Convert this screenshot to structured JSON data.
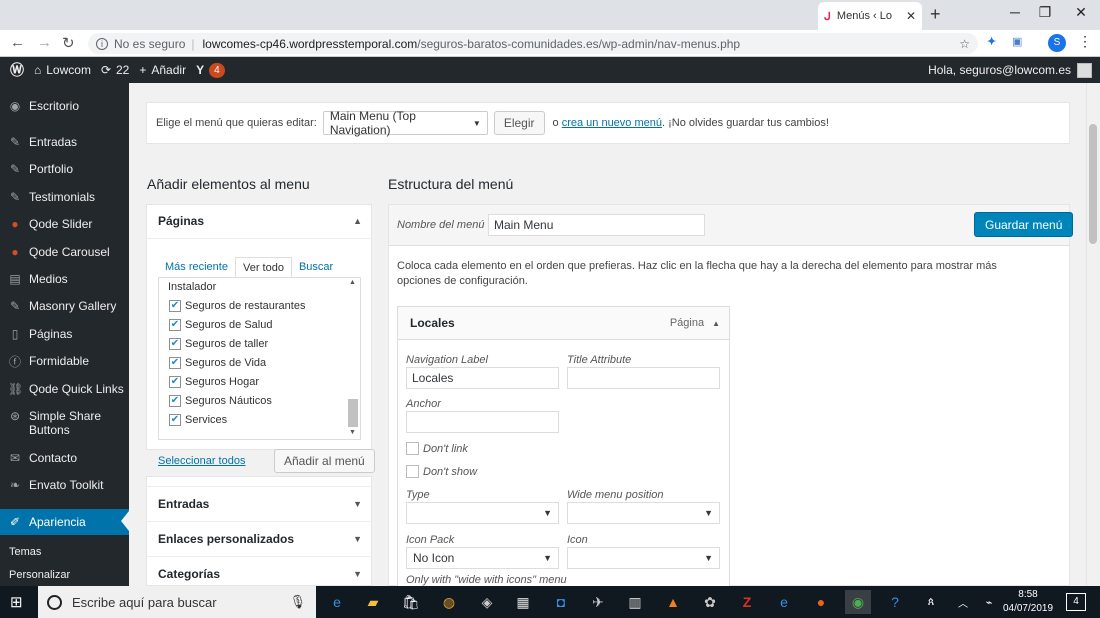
{
  "browser": {
    "tab_title": "Menús ‹ Lo",
    "tab_close": "✕",
    "new_tab": "+",
    "not_secure": "No es seguro",
    "url_host": "lowcomes-cp46.wordpresstemporal.com",
    "url_path": "/seguros-baratos-comunidades.es/wp-admin/nav-menus.php",
    "profile_initial": "S"
  },
  "adminbar": {
    "site": "Lowcom",
    "updates": "22",
    "add_new": "Añadir",
    "yoast_count": "4",
    "howdy": "Hola, seguros@lowcom.es"
  },
  "sidebar": {
    "items": [
      {
        "label": "Escritorio",
        "icon": "dashboard-icon"
      },
      {
        "label": "Entradas",
        "icon": "pin-icon"
      },
      {
        "label": "Portfolio",
        "icon": "pin-icon"
      },
      {
        "label": "Testimonials",
        "icon": "pin-icon"
      },
      {
        "label": "Qode Slider",
        "icon": "circle-icon"
      },
      {
        "label": "Qode Carousel",
        "icon": "circle-icon"
      },
      {
        "label": "Medios",
        "icon": "media-icon"
      },
      {
        "label": "Masonry Gallery",
        "icon": "pin-icon"
      },
      {
        "label": "Páginas",
        "icon": "page-icon"
      },
      {
        "label": "Formidable",
        "icon": "form-icon"
      },
      {
        "label": "Qode Quick Links",
        "icon": "link-icon"
      },
      {
        "label": "Simple Share Buttons",
        "icon": "share-icon"
      },
      {
        "label": "Contacto",
        "icon": "mail-icon"
      },
      {
        "label": "Envato Toolkit",
        "icon": "leaf-icon"
      },
      {
        "label": "Apariencia",
        "icon": "brush-icon"
      }
    ],
    "submenu": [
      "Temas",
      "Personalizar"
    ]
  },
  "select_menu": {
    "prompt": "Elige el menú que quieras editar:",
    "selected": "Main Menu (Top Navigation)",
    "choose_button": "Elegir",
    "or": "o",
    "create_link": "crea un nuevo menú",
    "reminder": ". ¡No olvides guardar tus cambios!"
  },
  "add_items": {
    "heading": "Añadir elementos al menu",
    "pages_section": "Páginas",
    "tabs": [
      "Más reciente",
      "Ver todo",
      "Buscar"
    ],
    "partial_item": "Instalador",
    "pages": [
      "Seguros de restaurantes",
      "Seguros de Salud",
      "Seguros de taller",
      "Seguros de Vida",
      "Seguros Hogar",
      "Seguros Náuticos",
      "Services"
    ],
    "select_all": "Seleccionar todos",
    "add_button": "Añadir al menú",
    "sections": [
      "Entradas",
      "Enlaces personalizados",
      "Categorías"
    ]
  },
  "structure": {
    "heading": "Estructura del menú",
    "name_label": "Nombre del menú",
    "name_value": "Main Menu",
    "save_button": "Guardar menú",
    "instructions": "Coloca cada elemento en el orden que prefieras. Haz clic en la flecha que hay a la derecha del elemento para mostrar más opciones de configuración.",
    "item_title": "Locales",
    "item_type": "Página",
    "nav_label": "Navigation Label",
    "nav_label_value": "Locales",
    "title_attr": "Title Attribute",
    "anchor": "Anchor",
    "dont_link": "Don't link",
    "dont_show": "Don't show",
    "type": "Type",
    "wide_pos": "Wide menu position",
    "icon_pack": "Icon Pack",
    "icon_pack_value": "No Icon",
    "icon": "Icon",
    "hint": "Only with \"wide with icons\" menu"
  },
  "taskbar": {
    "search_placeholder": "Escribe aquí para buscar",
    "time": "8:58",
    "date": "04/07/2019",
    "notif_count": "4"
  }
}
